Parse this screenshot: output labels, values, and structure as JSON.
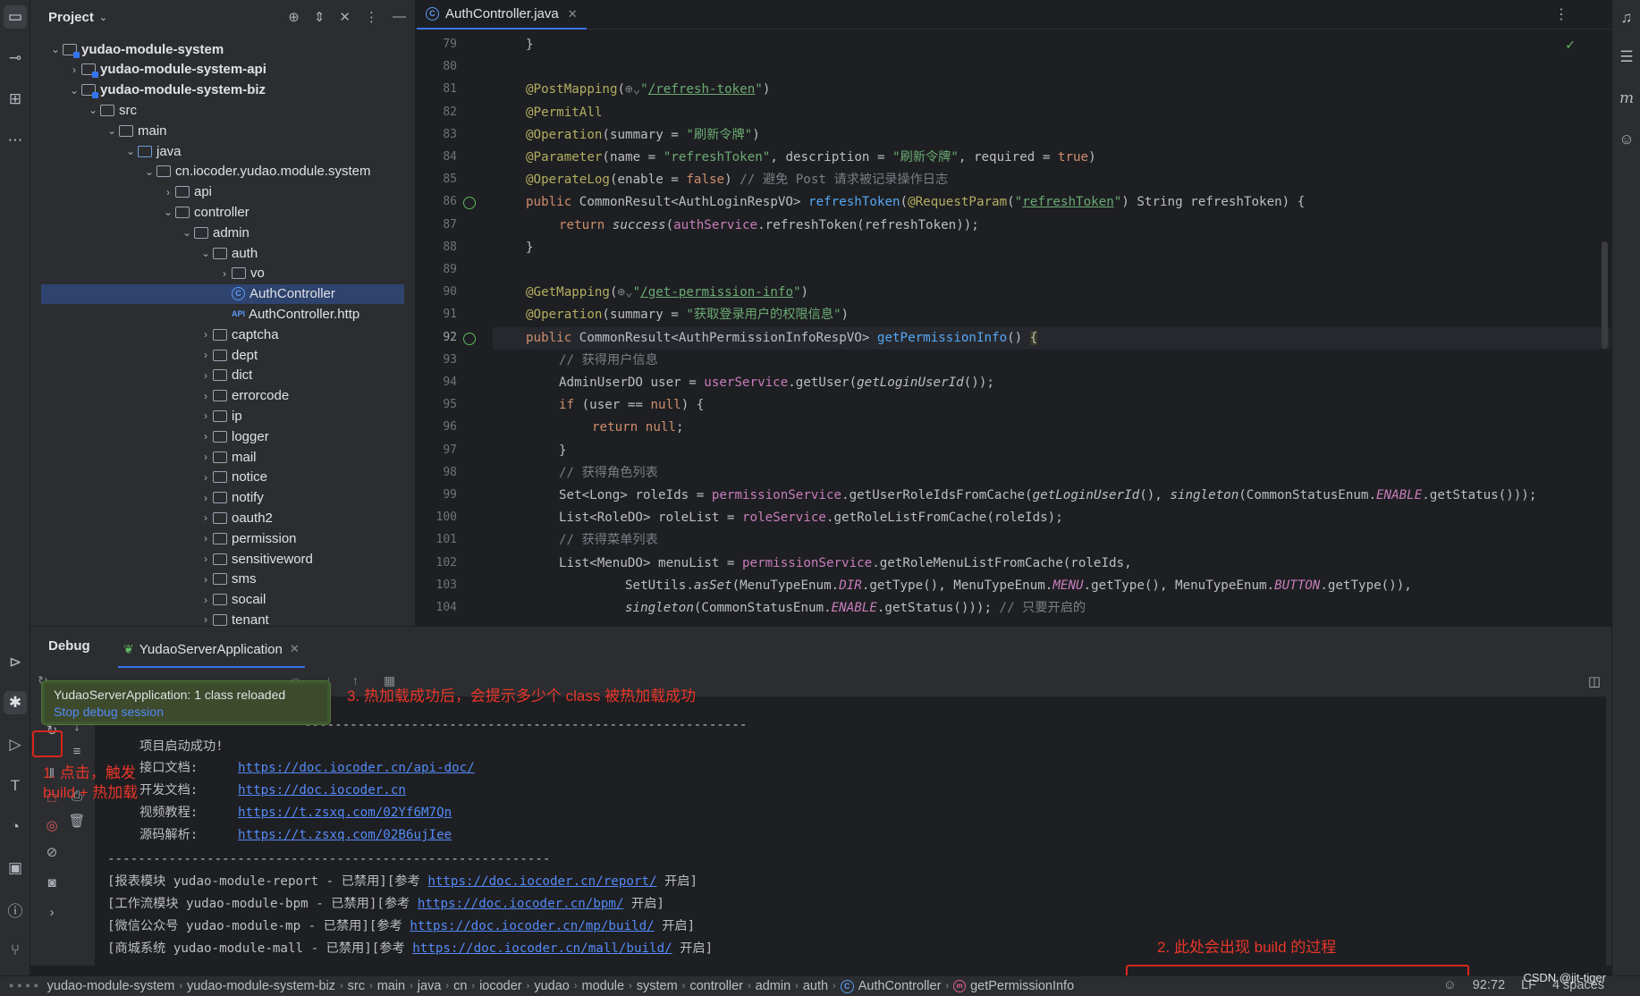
{
  "project_panel": {
    "title": "Project",
    "tree": [
      {
        "label": "yudao-module-system",
        "depth": 0,
        "arrow": "open",
        "icon": "module",
        "bold": true
      },
      {
        "label": "yudao-module-system-api",
        "depth": 1,
        "arrow": "closed",
        "icon": "module",
        "bold": true
      },
      {
        "label": "yudao-module-system-biz",
        "depth": 1,
        "arrow": "open",
        "icon": "module",
        "bold": true
      },
      {
        "label": "src",
        "depth": 2,
        "arrow": "open",
        "icon": "folder"
      },
      {
        "label": "main",
        "depth": 3,
        "arrow": "open",
        "icon": "folder"
      },
      {
        "label": "java",
        "depth": 4,
        "arrow": "open",
        "icon": "src"
      },
      {
        "label": "cn.iocoder.yudao.module.system",
        "depth": 5,
        "arrow": "open",
        "icon": "package"
      },
      {
        "label": "api",
        "depth": 6,
        "arrow": "closed",
        "icon": "package"
      },
      {
        "label": "controller",
        "depth": 6,
        "arrow": "open",
        "icon": "package"
      },
      {
        "label": "admin",
        "depth": 7,
        "arrow": "open",
        "icon": "package"
      },
      {
        "label": "auth",
        "depth": 8,
        "arrow": "open",
        "icon": "package"
      },
      {
        "label": "vo",
        "depth": 9,
        "arrow": "closed",
        "icon": "package"
      },
      {
        "label": "AuthController",
        "depth": 9,
        "arrow": "none",
        "icon": "class",
        "selected": true
      },
      {
        "label": "AuthController.http",
        "depth": 9,
        "arrow": "none",
        "icon": "http"
      },
      {
        "label": "captcha",
        "depth": 8,
        "arrow": "closed",
        "icon": "package"
      },
      {
        "label": "dept",
        "depth": 8,
        "arrow": "closed",
        "icon": "package"
      },
      {
        "label": "dict",
        "depth": 8,
        "arrow": "closed",
        "icon": "package"
      },
      {
        "label": "errorcode",
        "depth": 8,
        "arrow": "closed",
        "icon": "package"
      },
      {
        "label": "ip",
        "depth": 8,
        "arrow": "closed",
        "icon": "package"
      },
      {
        "label": "logger",
        "depth": 8,
        "arrow": "closed",
        "icon": "package"
      },
      {
        "label": "mail",
        "depth": 8,
        "arrow": "closed",
        "icon": "package"
      },
      {
        "label": "notice",
        "depth": 8,
        "arrow": "closed",
        "icon": "package"
      },
      {
        "label": "notify",
        "depth": 8,
        "arrow": "closed",
        "icon": "package"
      },
      {
        "label": "oauth2",
        "depth": 8,
        "arrow": "closed",
        "icon": "package"
      },
      {
        "label": "permission",
        "depth": 8,
        "arrow": "closed",
        "icon": "package"
      },
      {
        "label": "sensitiveword",
        "depth": 8,
        "arrow": "closed",
        "icon": "package"
      },
      {
        "label": "sms",
        "depth": 8,
        "arrow": "closed",
        "icon": "package"
      },
      {
        "label": "socail",
        "depth": 8,
        "arrow": "closed",
        "icon": "package"
      },
      {
        "label": "tenant",
        "depth": 8,
        "arrow": "closed",
        "icon": "package"
      }
    ]
  },
  "editor": {
    "tab_label": "AuthController.java",
    "code_lines": [
      {
        "num": "79",
        "html": "<span>}</span>",
        "indent": 1
      },
      {
        "num": "80",
        "html": "",
        "indent": 0
      },
      {
        "num": "81",
        "html": "<span class=\"a\">@PostMapping</span>(<span class=\"cm\">⊕⌄</span><span class=\"s\">\"<span class=\"url\">/refresh-token</span>\"</span>)",
        "indent": 1
      },
      {
        "num": "82",
        "html": "<span class=\"a\">@PermitAll</span>",
        "indent": 1
      },
      {
        "num": "83",
        "html": "<span class=\"a\">@Operation</span>(summary = <span class=\"s\">\"刷新令牌\"</span>)",
        "indent": 1
      },
      {
        "num": "84",
        "html": "<span class=\"a\">@Parameter</span>(name = <span class=\"s\">\"refreshToken\"</span>, description = <span class=\"s\">\"刷新令牌\"</span>, required = <span class=\"k\">true</span>)",
        "indent": 1
      },
      {
        "num": "85",
        "html": "<span class=\"a\">@OperateLog</span>(enable = <span class=\"k\">false</span>) <span class=\"cm\">// 避免 Post 请求被记录操作日志</span>",
        "indent": 1
      },
      {
        "num": "86",
        "html": "<span class=\"k\">public</span> CommonResult&lt;AuthLoginRespVO&gt; <span class=\"f\">refreshToken</span>(<span class=\"a\">@RequestParam</span>(<span class=\"s\">\"<span class=\"url\">refreshToken</span>\"</span>) String refreshToken) {",
        "indent": 1,
        "mark": true
      },
      {
        "num": "87",
        "html": "<span class=\"k\">return</span> <span class=\"it\">success</span>(<span class=\"fi\">authService</span>.refreshToken(refreshToken));",
        "indent": 2
      },
      {
        "num": "88",
        "html": "}",
        "indent": 1
      },
      {
        "num": "89",
        "html": "",
        "indent": 0
      },
      {
        "num": "90",
        "html": "<span class=\"a\">@GetMapping</span>(<span class=\"cm\">⊕⌄</span><span class=\"s\">\"<span class=\"url\">/get-permission-info</span>\"</span>)",
        "indent": 1
      },
      {
        "num": "91",
        "html": "<span class=\"a\">@Operation</span>(summary = <span class=\"s\">\"获取登录用户的权限信息\"</span>)",
        "indent": 1
      },
      {
        "num": "92",
        "html": "<span class=\"k\">public</span> CommonResult&lt;AuthPermissionInfoRespVO&gt; <span class=\"f\">getPermissionInfo</span>() <span class=\"br\">{</span>",
        "indent": 1,
        "mark": true,
        "current": true
      },
      {
        "num": "93",
        "html": "<span class=\"cm\">// 获得用户信息</span>",
        "indent": 2
      },
      {
        "num": "94",
        "html": "AdminUserDO user = <span class=\"fi\">userService</span>.getUser(<span class=\"it\">getLoginUserId</span>());",
        "indent": 2
      },
      {
        "num": "95",
        "html": "<span class=\"k\">if</span> (user == <span class=\"k\">null</span>) {",
        "indent": 2
      },
      {
        "num": "96",
        "html": "<span class=\"k\">return null</span>;",
        "indent": 3
      },
      {
        "num": "97",
        "html": "}",
        "indent": 2
      },
      {
        "num": "98",
        "html": "<span class=\"cm\">// 获得角色列表</span>",
        "indent": 2
      },
      {
        "num": "99",
        "html": "Set&lt;Long&gt; roleIds = <span class=\"fi\">permissionService</span>.getUserRoleIdsFromCache(<span class=\"it\">getLoginUserId</span>(), <span class=\"it\">singleton</span>(CommonStatusEnum.<span class=\"en\">ENABLE</span>.getStatus()));",
        "indent": 2
      },
      {
        "num": "100",
        "html": "List&lt;RoleDO&gt; roleList = <span class=\"fi\">roleService</span>.getRoleListFromCache(roleIds);",
        "indent": 2
      },
      {
        "num": "101",
        "html": "<span class=\"cm\">// 获得菜单列表</span>",
        "indent": 2
      },
      {
        "num": "102",
        "html": "List&lt;MenuDO&gt; menuList = <span class=\"fi\">permissionService</span>.getRoleMenuListFromCache(roleIds,",
        "indent": 2
      },
      {
        "num": "103",
        "html": "SetUtils.<span class=\"it\">asSet</span>(MenuTypeEnum.<span class=\"en\">DIR</span>.getType(), MenuTypeEnum.<span class=\"en\">MENU</span>.getType(), MenuTypeEnum.<span class=\"en\">BUTTON</span>.getType()),",
        "indent": 4
      },
      {
        "num": "104",
        "html": "<span class=\"it\">singleton</span>(CommonStatusEnum.<span class=\"en\">ENABLE</span>.getStatus())); <span class=\"cm\">// 只要开启的</span>",
        "indent": 4
      }
    ]
  },
  "debug": {
    "title": "Debug",
    "session_tab": "YudaoServerApplication",
    "console": {
      "separator": "----------------------------------------------------------",
      "startup": "项目启动成功!",
      "links": [
        {
          "label": "接口文档:",
          "url": "https://doc.iocoder.cn/api-doc/"
        },
        {
          "label": "开发文档:",
          "url": "https://doc.iocoder.cn"
        },
        {
          "label": "视频教程:",
          "url": "https://t.zsxq.com/02Yf6M7Qn"
        },
        {
          "label": "源码解析:",
          "url": "https://t.zsxq.com/02B6ujIee"
        }
      ],
      "modules": [
        {
          "prefix": "[报表模块 yudao-module-report - 已禁用][参考 ",
          "url": "https://doc.iocoder.cn/report/",
          "suffix": " 开启]"
        },
        {
          "prefix": "[工作流模块 yudao-module-bpm - 已禁用][参考 ",
          "url": "https://doc.iocoder.cn/bpm/",
          "suffix": " 开启]"
        },
        {
          "prefix": "[微信公众号 yudao-module-mp - 已禁用][参考 ",
          "url": "https://doc.iocoder.cn/mp/build/",
          "suffix": " 开启]"
        },
        {
          "prefix": "[商城系统 yudao-module-mall - 已禁用][参考 ",
          "url": "https://doc.iocoder.cn/mall/build/",
          "suffix": " 开启]"
        }
      ]
    }
  },
  "notification": {
    "message": "YudaoServerApplication: 1 class reloaded",
    "action": "Stop debug session"
  },
  "annotations": {
    "step1": "1. 点击，触发\nbuild + 热加载",
    "step2": "2. 此处会出现 build 的过程",
    "step3": "3. 热加载成功后，会提示多少个 class 被热加载成功"
  },
  "statusbar": {
    "breadcrumbs": [
      "yudao-module-system",
      "yudao-module-system-biz",
      "src",
      "main",
      "java",
      "cn",
      "iocoder",
      "yudao",
      "module",
      "system",
      "controller",
      "admin",
      "auth"
    ],
    "class_crumb": "AuthController",
    "method_crumb": "getPermissionInfo",
    "position": "92:72",
    "line_ending": "LF",
    "indent": "4 spaces"
  },
  "watermark": "CSDN @jit-tiger",
  "colors": {
    "annotation_red": "#e8362a",
    "accent_blue": "#3574f0",
    "background": "#1e1f22",
    "panel": "#2b2d30"
  }
}
